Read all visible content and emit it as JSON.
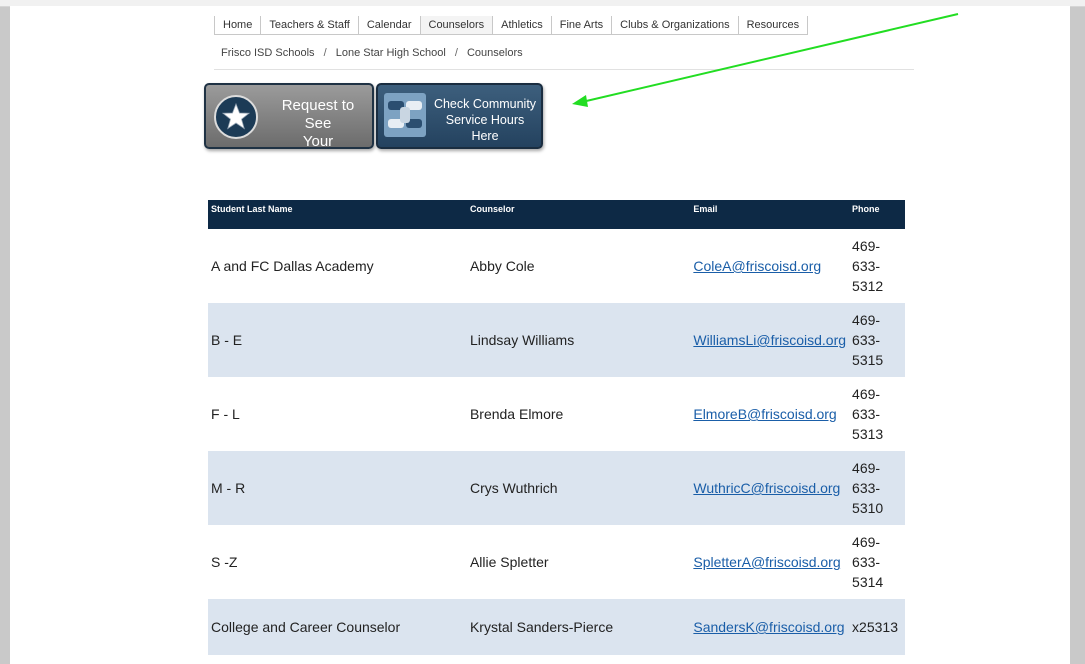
{
  "nav": {
    "tabs": [
      {
        "label": "Home"
      },
      {
        "label": "Teachers & Staff"
      },
      {
        "label": "Calendar"
      },
      {
        "label": "Counselors"
      },
      {
        "label": "Athletics"
      },
      {
        "label": "Fine Arts"
      },
      {
        "label": "Clubs & Organizations"
      },
      {
        "label": "Resources"
      }
    ]
  },
  "breadcrumb": {
    "items": [
      "Frisco ISD Schools",
      "Lone Star High School",
      "Counselors"
    ],
    "separator": "/"
  },
  "buttons": {
    "request": {
      "line1": "Request to See",
      "line2": "Your Counselor"
    },
    "service": {
      "line1": "Check Community",
      "line2": "Service Hours Here"
    }
  },
  "annotation": {
    "arrow_color": "#22dd22"
  },
  "table": {
    "headers": [
      "Student Last Name",
      "Counselor",
      "Email",
      "Phone"
    ],
    "rows": [
      {
        "range": "A and FC Dallas Academy",
        "counselor": "Abby Cole",
        "email": "ColeA@friscoisd.org",
        "phone": [
          "469-",
          "633-",
          "5312"
        ]
      },
      {
        "range": "B - E",
        "counselor": "Lindsay Williams",
        "email": "WilliamsLi@friscoisd.org",
        "phone": [
          "469-",
          "633-",
          "5315"
        ]
      },
      {
        "range": "F - L",
        "counselor": "Brenda Elmore",
        "email": "ElmoreB@friscoisd.org",
        "phone": [
          "469-",
          "633-",
          "5313"
        ]
      },
      {
        "range": "M - R",
        "counselor": "Crys Wuthrich",
        "email": "WuthricC@friscoisd.org",
        "phone": [
          "469-",
          "633-",
          "5310"
        ]
      },
      {
        "range": "S -Z",
        "counselor": "Allie Spletter",
        "email": "SpletterA@friscoisd.org",
        "phone": [
          "469-",
          "633-",
          "5314"
        ]
      },
      {
        "range": "College and Career Counselor",
        "counselor": "Krystal Sanders-Pierce",
        "email": "SandersK@friscoisd.org",
        "phone": [
          "x25313"
        ]
      }
    ]
  },
  "colors": {
    "header_bg": "#0d2945",
    "row_alt": "#dbe4ef",
    "link": "#1a5ea8"
  }
}
